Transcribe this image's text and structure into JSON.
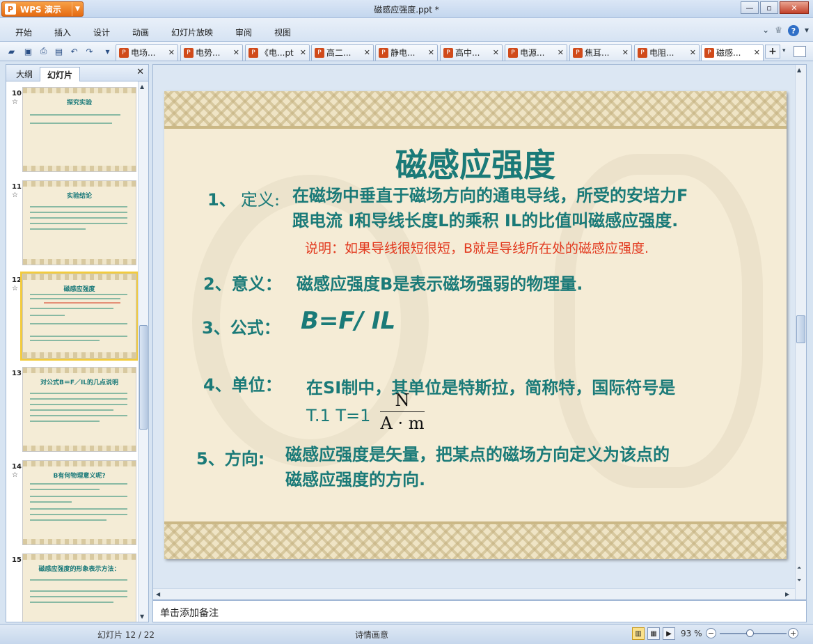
{
  "app": {
    "name": "WPS 演示",
    "doc_title": "磁感应强度.ppt *"
  },
  "menu": [
    "开始",
    "插入",
    "设计",
    "动画",
    "幻灯片放映",
    "审阅",
    "视图"
  ],
  "tabs": [
    {
      "label": "电场..."
    },
    {
      "label": "电势..."
    },
    {
      "label": "《电...pt"
    },
    {
      "label": "高二..."
    },
    {
      "label": "静电..."
    },
    {
      "label": "高中..."
    },
    {
      "label": "电源..."
    },
    {
      "label": "焦耳..."
    },
    {
      "label": "电阻..."
    },
    {
      "label": "磁感..."
    }
  ],
  "left_panel": {
    "tab_outline": "大纲",
    "tab_slides": "幻灯片",
    "thumbnails": [
      {
        "num": "10",
        "title": "探究实验"
      },
      {
        "num": "11",
        "title": "实验结论"
      },
      {
        "num": "12",
        "title": "磁感应强度"
      },
      {
        "num": "13",
        "title": "对公式B＝F／IL的几点说明"
      },
      {
        "num": "14",
        "title": "B有何物理意义呢?"
      },
      {
        "num": "15",
        "title": "磁感应强度的形象表示方法："
      }
    ]
  },
  "slide": {
    "title": "磁感应强度",
    "item1_num": "1、",
    "item1_label": "定义:",
    "item1_line1": "在磁场中垂直于磁场方向的通电导线，所受的安培力F",
    "item1_line2": "跟电流 I和导线长度L的乘积 IL的比值叫磁感应强度.",
    "item1_note": "说明：如果导线很短很短，B就是导线所在处的磁感应强度.",
    "item2_label": "2、意义：",
    "item2_text": "磁感应强度B是表示磁场强弱的物理量.",
    "item3_label": "3、公式：",
    "item3_formula": "B=F/ IL",
    "item4_label": "4、单位：",
    "item4_line1": "在SI制中，其单位是特斯拉，简称特，国际符号是",
    "item4_line2": "T.1  T=1",
    "item4_frac_num": "N",
    "item4_frac_den": "A · m",
    "item5_label": "5、方向:",
    "item5_line1": "磁感应强度是矢量，把某点的磁场方向定义为该点的",
    "item5_line2": "磁感应强度的方向."
  },
  "notes_placeholder": "单击添加备注",
  "status": {
    "slide_counter": "幻灯片 12 / 22",
    "theme": "诗情画意",
    "zoom": "93 %"
  }
}
